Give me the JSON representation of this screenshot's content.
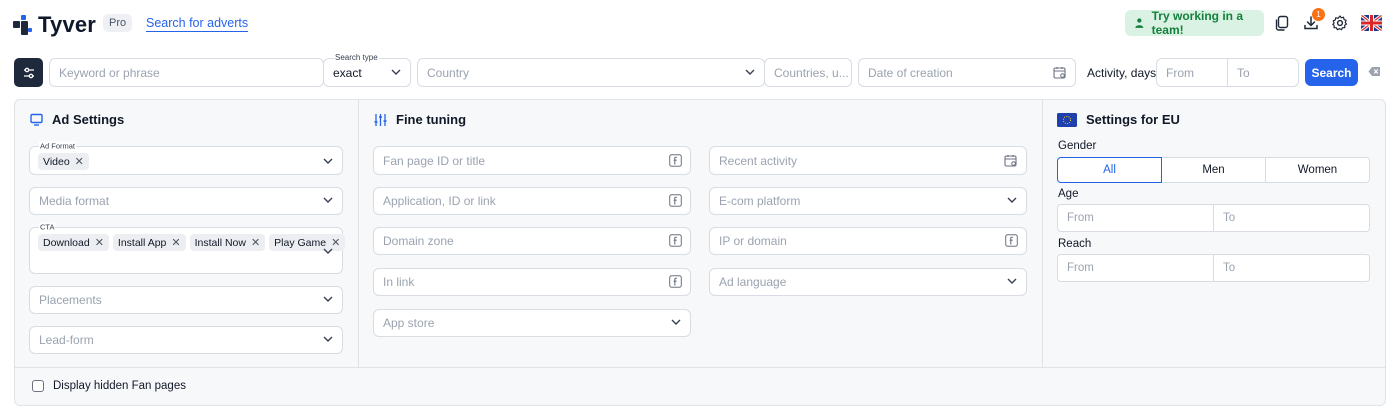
{
  "header": {
    "logo_text": "Tyver",
    "plan_badge": "Pro",
    "search_link": "Search for adverts",
    "team_button": "Try working in a team!",
    "notification_count": "1",
    "icons": [
      "copy-icon",
      "download-icon",
      "settings-icon",
      "uk-flag-icon"
    ]
  },
  "search_bar": {
    "keyword_placeholder": "Keyword or phrase",
    "search_type_label": "Search type",
    "search_type_value": "exact",
    "country_placeholder": "Country",
    "countries_placeholder": "Countries, u...",
    "date_placeholder": "Date of creation",
    "activity_label": "Activity, days",
    "from_placeholder": "From",
    "to_placeholder": "To",
    "search_button": "Search"
  },
  "ad_settings": {
    "title": "Ad Settings",
    "ad_format_label": "Ad Format",
    "ad_format_chips": [
      "Video"
    ],
    "media_format_placeholder": "Media format",
    "cta_label": "CTA",
    "cta_chips": [
      "Download",
      "Install App",
      "Install Now",
      "Play Game"
    ],
    "placements_placeholder": "Placements",
    "lead_form_placeholder": "Lead-form"
  },
  "fine_tuning": {
    "title": "Fine tuning",
    "fan_page": "Fan page ID or title",
    "application": "Application, ID or link",
    "domain_zone": "Domain zone",
    "in_link": "In link",
    "app_store": "App store",
    "recent_activity": "Recent activity",
    "ecom_platform": "E-com platform",
    "ip_domain": "IP or domain",
    "ad_language": "Ad language"
  },
  "eu_settings": {
    "title": "Settings for EU",
    "gender_label": "Gender",
    "gender_options": [
      "All",
      "Men",
      "Women"
    ],
    "gender_selected": "All",
    "age_label": "Age",
    "reach_label": "Reach",
    "from_placeholder": "From",
    "to_placeholder": "To"
  },
  "footer": {
    "hidden_fan_pages": "Display hidden Fan pages"
  },
  "colors": {
    "accent": "#2563eb",
    "dark": "#1e293b",
    "team_bg": "#d9f2e3",
    "team_text": "#15803d",
    "badge": "#f97316"
  }
}
